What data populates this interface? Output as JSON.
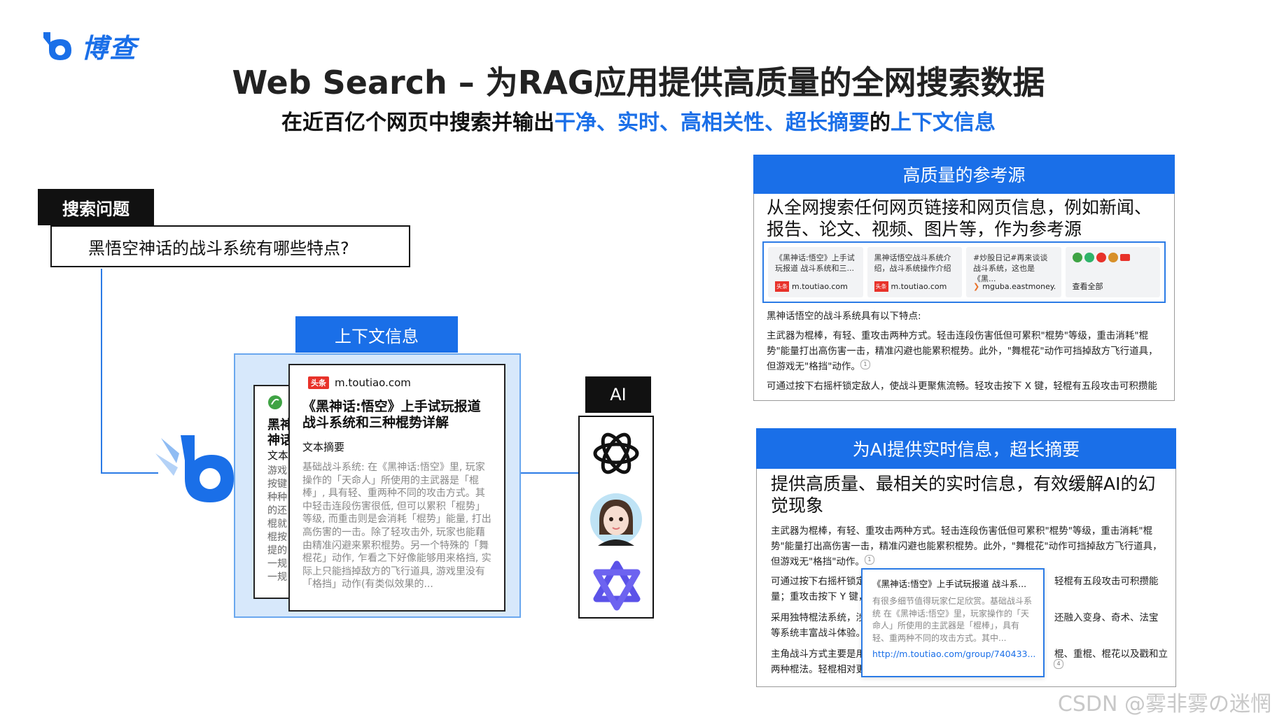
{
  "logo": {
    "text": "博查"
  },
  "title": "Web Search – 为RAG应用提供高质量的全网搜索数据",
  "subtitle": {
    "part1": "在近百亿个网页中搜索并输出",
    "highlight1": "干净、实时、高相关性、超长摘要",
    "part2": "的",
    "highlight2": "上下文信息"
  },
  "query": {
    "label": "搜索问题",
    "text": "黑悟空神话的战斗系统有哪些特点?"
  },
  "context": {
    "label": "上下文信息",
    "back_card": {
      "title": "黑神\n神话",
      "summary_label": "文本",
      "body": "游戏\n按键\n种种\n的还\n棍就\n棍按\n提的\n一规\n一规"
    },
    "front_card": {
      "source": "m.toutiao.com",
      "source_badge": "头条",
      "title": "《黑神话:悟空》上手试玩报道战斗系统和三种棍势详解",
      "summary_label": "文本摘要",
      "body": "基础战斗系统: 在《黑神话:悟空》里, 玩家操作的「天命人」所使用的主武器是「棍棒」, 具有轻、重两种不同的攻击方式。其中轻击连段伤害很低, 但可以累积「棍势」等级, 而重击则是会消耗「棍势」能量, 打出高伤害的一击。除了轻攻击外, 玩家也能藉由精准闪避来累积棍势。另一个特殊的「舞棍花」动作, 乍看之下好像能够用来格挡, 实际上只能挡掉敌方的飞行道具, 游戏里没有「格挡」动作(有类似效果的..."
    }
  },
  "ai": {
    "label": "AI",
    "models": [
      "openai-logo",
      "assistant-avatar",
      "qwen-logo"
    ]
  },
  "panel_sources": {
    "header": "高质量的参考源",
    "heading": "从全网搜索任何网页链接和网页信息，例如新闻、报告、论文、视频、图片等，作为参考源",
    "refs": [
      {
        "title": "《黑神话:悟空》上手试玩报道 战斗系统和三...",
        "badge": "头条",
        "url": "m.toutiao.com"
      },
      {
        "title": "黑神话悟空战斗系统介绍，战斗系统操作介绍",
        "badge": "头条",
        "url": "m.toutiao.com"
      },
      {
        "title": "#炒股日记#再来谈谈战斗系统，这也是《黑...",
        "badge": "",
        "url": "mguba.eastmoney."
      }
    ],
    "view_all": "查看全部",
    "intro": "黑神话悟空的战斗系统具有以下特点:",
    "para1": "主武器为棍棒，有轻、重攻击两种方式。轻击连段伤害低但可累积\"棍势\"等级，重击消耗\"棍势\"能量打出高伤害一击，精准闪避也能累积棍势。此外，\"舞棍花\"动作可挡掉敌方飞行道具，但游戏无\"格挡\"动作。",
    "cite1": "1",
    "para2": "可通过按下右摇杆锁定敌人，使战斗更聚焦流畅。轻攻击按下 X 键，轻棍有五段攻击可积攒能"
  },
  "panel_realtime": {
    "header": "为AI提供实时信息，超长摘要",
    "heading": "提供高质量、最相关的实时信息，有效缓解AI的幻觉现象",
    "para1": "主武器为棍棒，有轻、重攻击两种方式。轻击连段伤害低但可累积\"棍势\"等级，重击消耗\"棍势\"能量打出高伤害一击，精准闪避也能累积棍势。此外，\"舞棍花\"动作可挡掉敌方飞行道具，但游戏无\"格挡\"动作。",
    "cite1": "1",
    "row2_left": "可通过按下右摇杆锁定",
    "row2_right": "轻棍有五段攻击可积攒能",
    "row3_left": "量；重攻击按下 Y 键，",
    "row4_left": "采用独特棍法系统，涉",
    "row4_right": "还融入变身、奇术、法宝",
    "row5_left": "等系统丰富战斗体验。",
    "row6_left": "主角战斗方式主要是用",
    "row6_right": "棍、重棍、棍花以及戳和立",
    "row7_left": "两种棍法。轻棍相对更",
    "cite4": "4",
    "popup": {
      "title": "《黑神话:悟空》上手试玩报道 战斗系...",
      "body": "有很多细节值得玩家仁足欣赏。基础战斗系统 在《黑神话:悟空》里，玩家操作的「天命人」所使用的主武器是「棍棒」，具有轻、重两种不同的攻击方式。其中...",
      "url": "http://m.toutiao.com/group/740433..."
    }
  },
  "watermark": "CSDN @雾非雾の迷惘",
  "colors": {
    "accent": "#1a6fe8",
    "panel_bg": "#d7e8fb",
    "badge_red": "#e8322a"
  }
}
